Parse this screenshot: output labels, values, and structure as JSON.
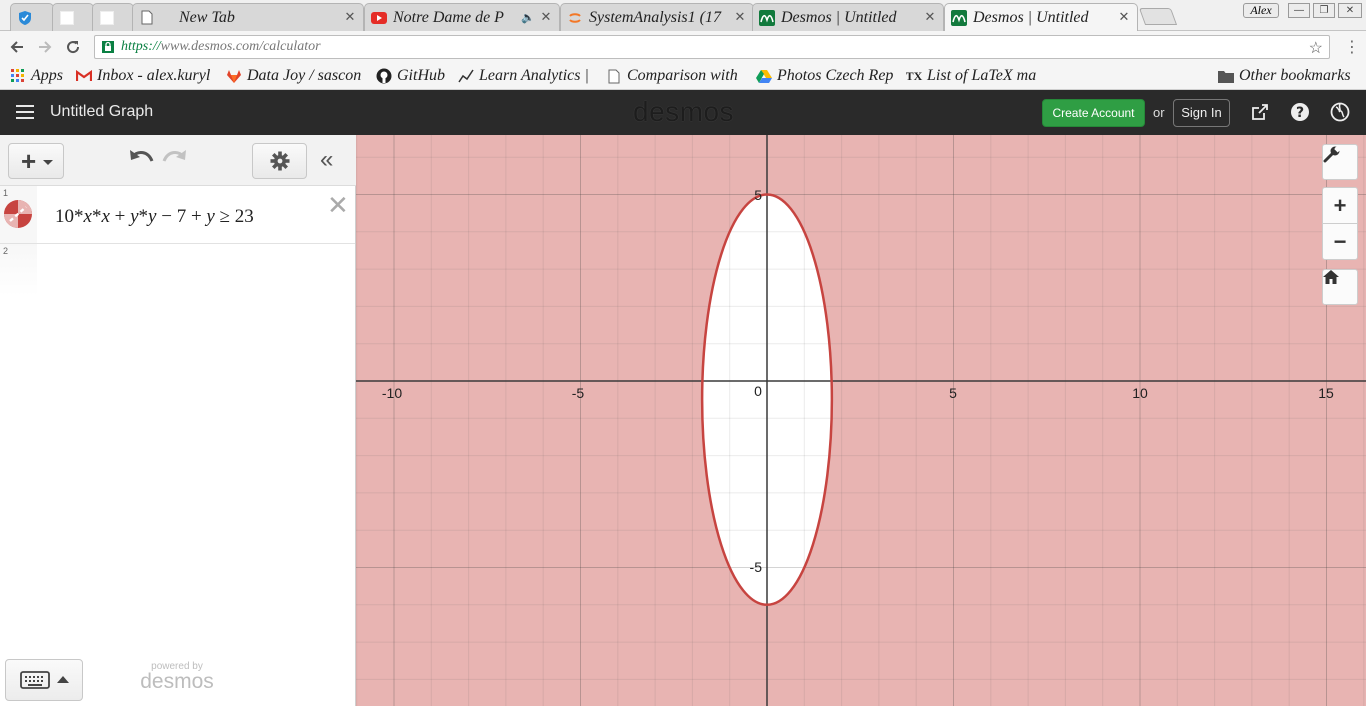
{
  "browser": {
    "tabs": [
      {
        "title": "",
        "favicon": "shield-icon",
        "active": false
      },
      {
        "title": "",
        "favicon": "blank-page-icon",
        "active": false
      },
      {
        "title": "",
        "favicon": "blank-page-icon",
        "active": false
      },
      {
        "title": "New Tab",
        "favicon": "page-icon",
        "active": false
      },
      {
        "title": "Notre Dame de P",
        "favicon": "youtube-icon",
        "active": false,
        "audio": true
      },
      {
        "title": "SystemAnalysis1 (17",
        "favicon": "jupyter-icon",
        "active": false
      },
      {
        "title": "Desmos | Untitled",
        "favicon": "desmos-icon",
        "active": false
      },
      {
        "title": "Desmos | Untitled",
        "favicon": "desmos-icon",
        "active": true
      }
    ],
    "tab_close": "✕",
    "speaker": "🔈",
    "profile_name": "Alex",
    "window_buttons": [
      "—",
      "❐",
      "✕"
    ],
    "url_scheme": "https://",
    "url_rest": "www.desmos.com/calculator",
    "bookmarks": [
      {
        "label": "Apps",
        "icon": "apps-grid-icon"
      },
      {
        "label": "Inbox - alex.kuryl",
        "icon": "gmail-icon"
      },
      {
        "label": "Data Joy / sascon",
        "icon": "gitlab-icon"
      },
      {
        "label": "GitHub",
        "icon": "github-icon"
      },
      {
        "label": "Learn Analytics |",
        "icon": "analytics-icon"
      },
      {
        "label": "Comparison with",
        "icon": "page-icon"
      },
      {
        "label": "Photos Czech Rep",
        "icon": "drive-icon"
      },
      {
        "label": "List of LaTeX ma",
        "icon": "tex-icon"
      }
    ],
    "other_bookmarks": "Other bookmarks"
  },
  "desmos": {
    "graph_title": "Untitled Graph",
    "logo": "desmos",
    "create_account": "Create Account",
    "or": "or",
    "sign_in": "Sign In",
    "expressions": [
      {
        "index": "1",
        "latex_parts": [
          "10",
          "*",
          "x",
          "*",
          "x",
          " + ",
          "y",
          "*",
          "y",
          " − ",
          "7",
          " + ",
          "y",
          " ≥ ",
          "23"
        ],
        "color": "#c74440"
      },
      {
        "index": "2",
        "latex_parts": []
      }
    ],
    "delete_symbol": "✕",
    "powered_by": "powered by",
    "powered_logo": "desmos"
  },
  "graph": {
    "x_ticks": [
      "-10",
      "-5",
      "0",
      "5",
      "10",
      "15"
    ],
    "y_ticks": [
      "5",
      "-5"
    ],
    "shade_color": "#e8b4b2",
    "curve_color": "#c74440"
  }
}
